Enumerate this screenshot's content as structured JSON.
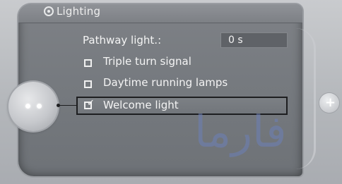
{
  "window": {
    "title": "Lighting",
    "title_icon": "lighting-settings-icon"
  },
  "settings": {
    "pathway": {
      "label": "Pathway light.:",
      "value": "0 s"
    },
    "items": [
      {
        "label": "Triple turn signal",
        "checked": false
      },
      {
        "label": "Daytime running lamps",
        "checked": false
      },
      {
        "label": "Welcome light",
        "checked": true,
        "selected": true
      }
    ]
  },
  "controls": {
    "right_button_glyph": "+"
  },
  "watermark": {
    "text": "فارما"
  },
  "colors": {
    "screen": "#767a7f",
    "text": "#f4f4f4",
    "focus_border": "#1d1e20"
  }
}
